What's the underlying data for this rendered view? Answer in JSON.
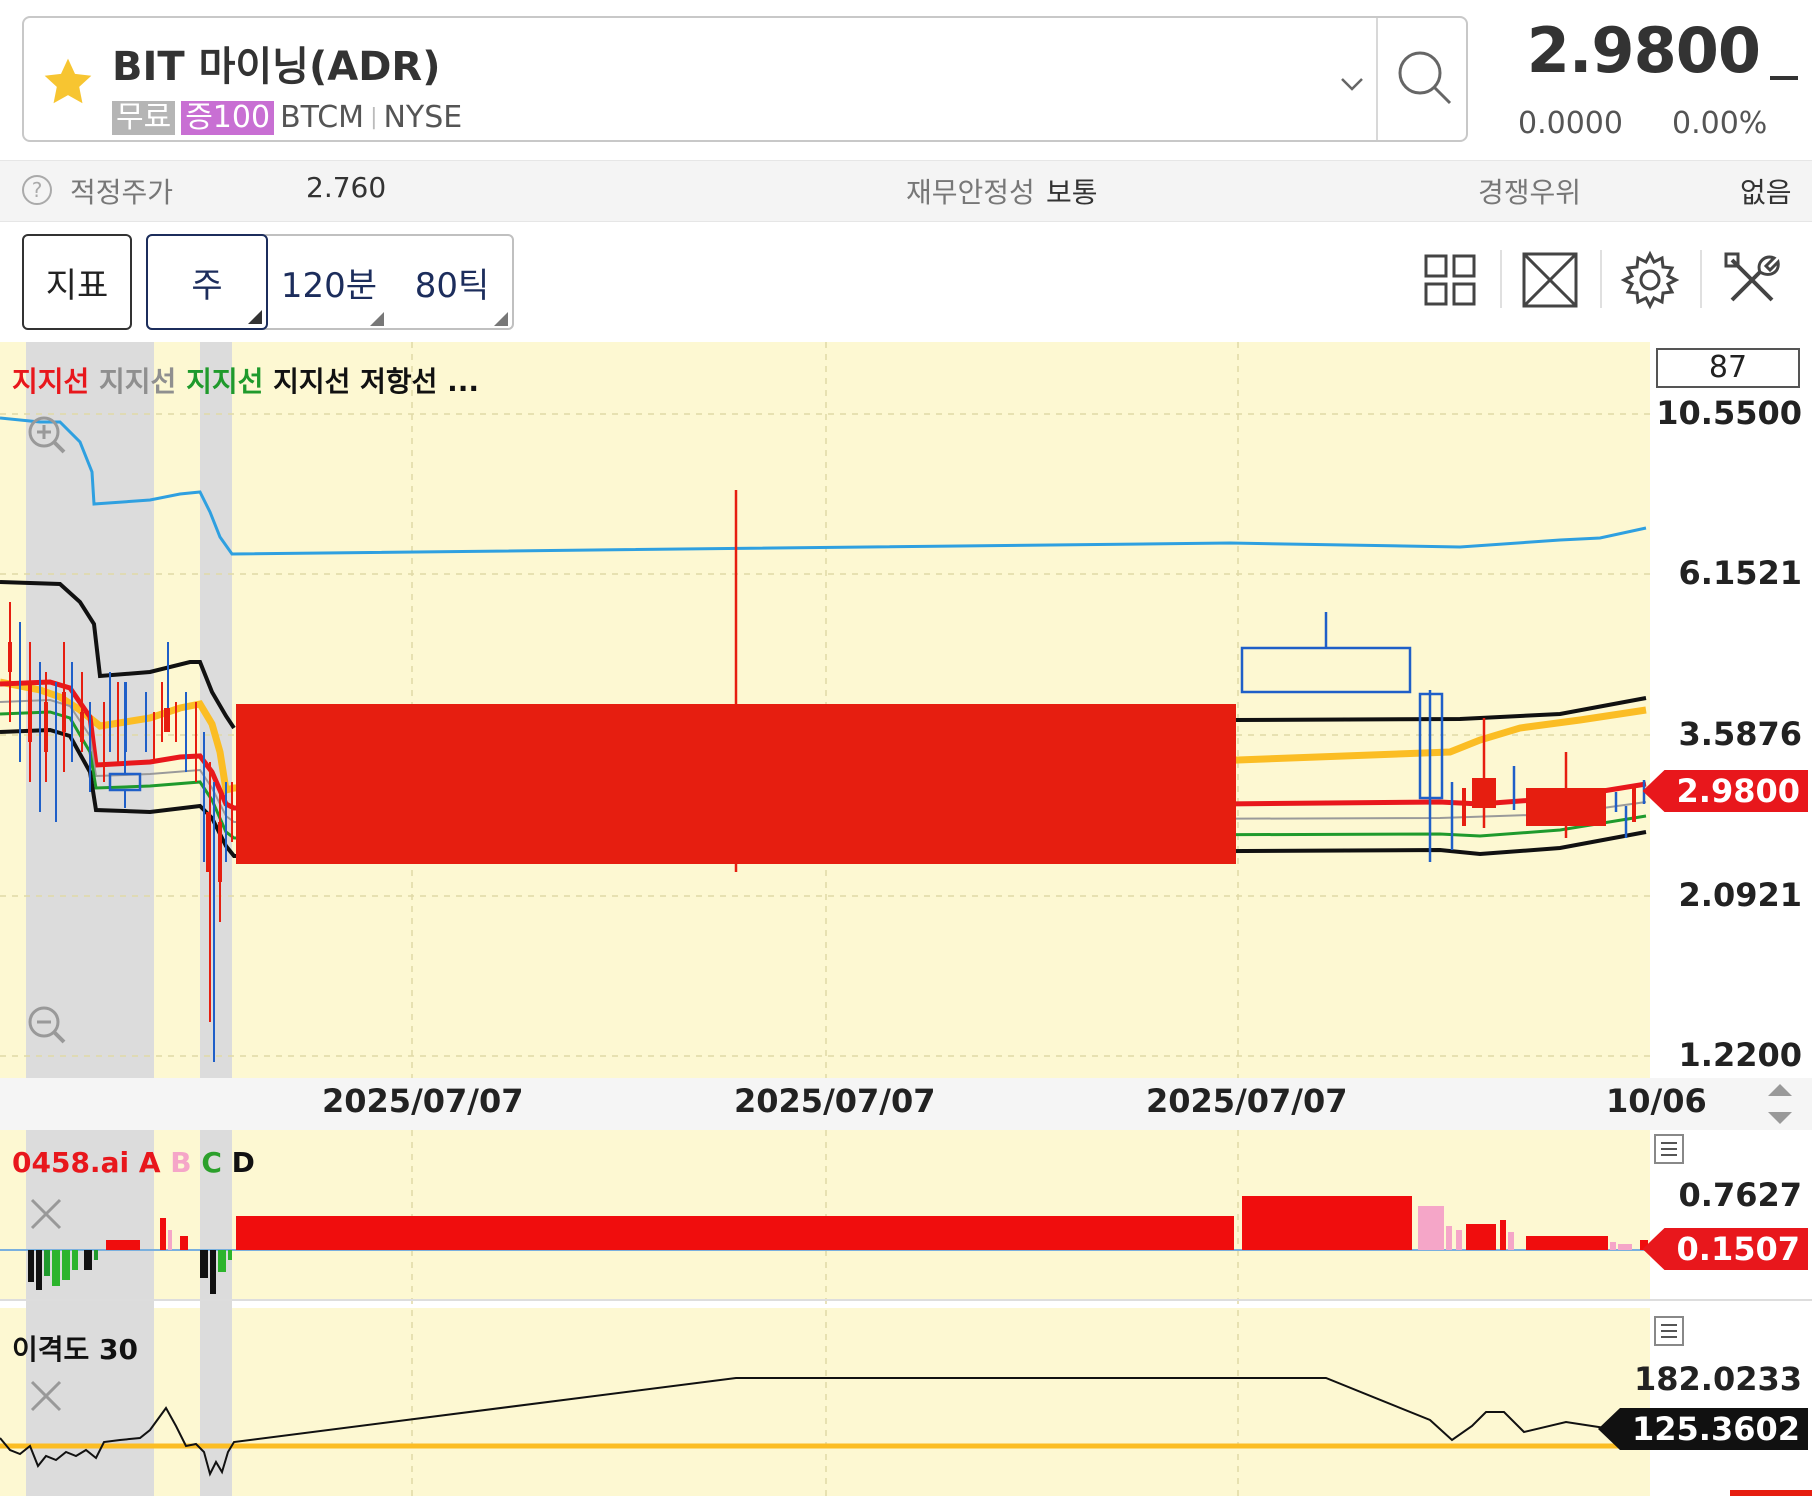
{
  "header": {
    "stock_name": "BIT 마이닝(ADR)",
    "tag_free": "무료",
    "tag_margin": "증100",
    "ticker": "BTCM",
    "exchange": "NYSE",
    "price": "2.9800",
    "change": "0.0000",
    "change_pct": "0.00%"
  },
  "infobar": {
    "fair_price_label": "적정주가",
    "fair_price_value": "2.760",
    "stability_label": "재무안정성",
    "stability_value": "보통",
    "competitive_label": "경쟁우위",
    "competitive_value": "없음"
  },
  "toolbar": {
    "indicator": "지표",
    "period_week": "주",
    "period_120min": "120분",
    "period_80tick": "80틱"
  },
  "chart_data": [
    {
      "type": "candlestick",
      "legend": [
        "지지선",
        "지지선",
        "지지선",
        "지지선",
        "저항선",
        "..."
      ],
      "legend_colors": [
        "#e8171c",
        "#8f8f8f",
        "#1f9a2c",
        "#000000",
        "#000000",
        "#000000"
      ],
      "top_count": "87",
      "y_ticks": [
        "10.5500",
        "6.1521",
        "3.5876",
        "2.0921",
        "1.2200"
      ],
      "y_scale": "log",
      "x_ticks": [
        "2025/07/07",
        "2025/07/07",
        "2025/07/07",
        "10/06"
      ],
      "last_price": "2.9800",
      "colors": {
        "up": "#e61e10",
        "down": "#1f5fc8",
        "bg": "#fdf8d2",
        "shade": "#dcdcdc"
      }
    },
    {
      "type": "bar",
      "title": "0458.ai",
      "legend": [
        "A",
        "B",
        "C",
        "D"
      ],
      "legend_colors": [
        "#e8171c",
        "#f5a6c8",
        "#2ca02c",
        "#000000"
      ],
      "y_ticks": [
        "0.7627"
      ],
      "last_value": "0.1507"
    },
    {
      "type": "line",
      "title": "이격도 30",
      "y_ticks": [
        "182.0233"
      ],
      "last_value": "125.3602"
    }
  ]
}
